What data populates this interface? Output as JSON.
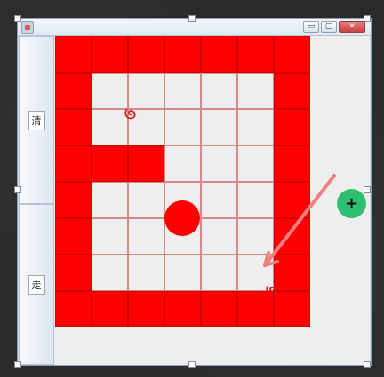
{
  "window": {
    "title": "",
    "controls": {
      "minimize": "▭",
      "maximize": "▢",
      "close": "✕"
    }
  },
  "sidebar": {
    "top_label": "清",
    "bottom_label": "走"
  },
  "board": {
    "cols": 7,
    "rows": 8,
    "cells": [
      [
        "wall",
        "wall",
        "wall",
        "wall",
        "wall",
        "wall",
        "wall"
      ],
      [
        "wall",
        "floor",
        "floor",
        "floor",
        "floor",
        "floor",
        "wall"
      ],
      [
        "wall",
        "floor",
        "floor",
        "floor",
        "floor",
        "floor",
        "wall"
      ],
      [
        "wall",
        "wall",
        "wall",
        "floor",
        "floor",
        "floor",
        "wall"
      ],
      [
        "wall",
        "floor",
        "floor",
        "floor",
        "floor",
        "floor",
        "wall"
      ],
      [
        "wall",
        "floor",
        "floor",
        "floor",
        "floor",
        "floor",
        "wall"
      ],
      [
        "wall",
        "floor",
        "floor",
        "floor",
        "floor",
        "floor",
        "wall"
      ],
      [
        "wall",
        "wall",
        "wall",
        "wall",
        "wall",
        "wall",
        "wall"
      ]
    ]
  },
  "overlay": {
    "cursor_plus": "+",
    "colors": {
      "wall": "#ff0000",
      "floor": "#eeeeee",
      "grid": "#d58a8a",
      "annotation": "#d61f1f",
      "arrow": "#f07f7f",
      "cursor": "#2fbf71"
    },
    "icons": {
      "app": "app-icon",
      "start_mark": "swirl-mark-icon",
      "end_mark": "swirl-mark-icon",
      "cursor": "plus-icon"
    }
  }
}
